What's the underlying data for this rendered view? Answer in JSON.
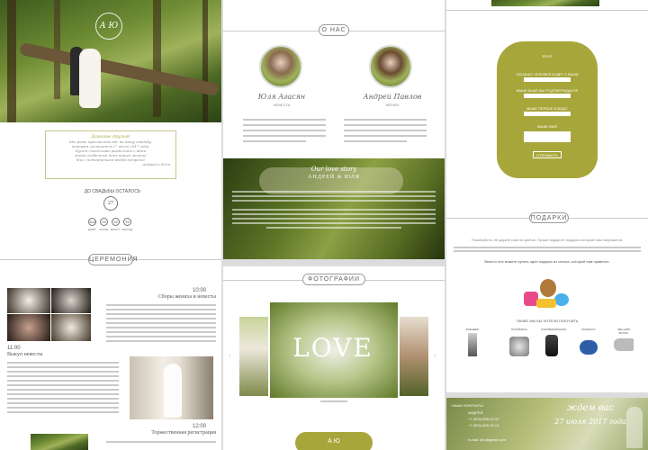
{
  "couple_names": "Андрей & Юля",
  "monogram": "А Ю",
  "invite_card": {
    "title": "Дорогие друзья!",
    "lines": [
      "Мы рады пригласить вас на нашу свадьбу,",
      "которая состоится 27 июля 2017 года.",
      "Будем счастливы разделить с вами",
      "этот особенный день нашей жизни!",
      "Мы с нетерпением ждём встречи!"
    ],
    "signature": "Андрей и Юля"
  },
  "countdown": {
    "heading": "ДО СВАДЬБЫ ОСТАЛОСЬ",
    "badge": "27",
    "values": [
      "154",
      "25",
      "25",
      "25"
    ],
    "labels": [
      "ДНЕЙ",
      "ЧАСОВ",
      "МИНУТ",
      "СЕКУНД"
    ]
  },
  "about": {
    "heading": "О НАС",
    "bride": {
      "name": "Юля Агасян",
      "sub": "НЕВЕСТА"
    },
    "groom": {
      "name": "Андрей Павлов",
      "sub": "ЖЕНИХ"
    }
  },
  "love_story": {
    "script": "Our love story",
    "names": "АНДРЕЙ & ЮЛЯ"
  },
  "ceremony": {
    "heading": "ЦЕРЕМОНИЯ",
    "event1_time": "10:00",
    "event1_title": "Сборы жениха и невесты",
    "event2_time": "11:00",
    "event2_title": "Выкуп невесты",
    "event3_time": "12:00",
    "event3_title": "Торжественная регистрация"
  },
  "photos": {
    "heading": "ФОТОГРАФИИ",
    "love_letters": "LOVE"
  },
  "rsvp": {
    "heading": "RSVP",
    "lines": [
      "СКОЛЬКО ЧЕЛОВЕК БУДЕТ С ВАМИ",
      "ВАШЕ ВАШЕ ВЫ ПОДТВЕРЖДАЕТЕ",
      "ВАШЕ ПЕРВОЕ БЛЮДО"
    ],
    "field_placeholder": "ВАШЕ ИМЯ",
    "button": "ОТПРАВИТЬ"
  },
  "gifts": {
    "heading": "ПОДАРКИ",
    "intro": "Пожалуйста, не дарите нам ни цветов. Лучше подарите подарок который нам понравится.",
    "line2": "Вместо них можете купить один подарок из списка, который нам нравится.",
    "list_heading": "ТАКЖЕ МЫ БЫ ХОТЕЛИ ПОЛУЧИТЬ",
    "items": [
      "БЛЕНДЕР",
      "ПАРОВАРКА",
      "СОКОВЫЖИМАЛКА",
      "ПЫЛЕСОС",
      "ФЕН ДЛЯ ВОЛОС"
    ]
  },
  "footer": {
    "left_title": "НАШИ КОНТАКТЫ",
    "name": "АНДРЕЙ",
    "phone1": "+7 (903) 555-22-12",
    "phone2": "+7 (903) 555-22-13",
    "email": "e-mail: info@gmail.com",
    "script": "ждем вас",
    "date": "27 июля 2017 года",
    "bottom_badge": "А Ю"
  },
  "colors": {
    "accent": "#a7a63a",
    "forest": "#4f6a25"
  }
}
